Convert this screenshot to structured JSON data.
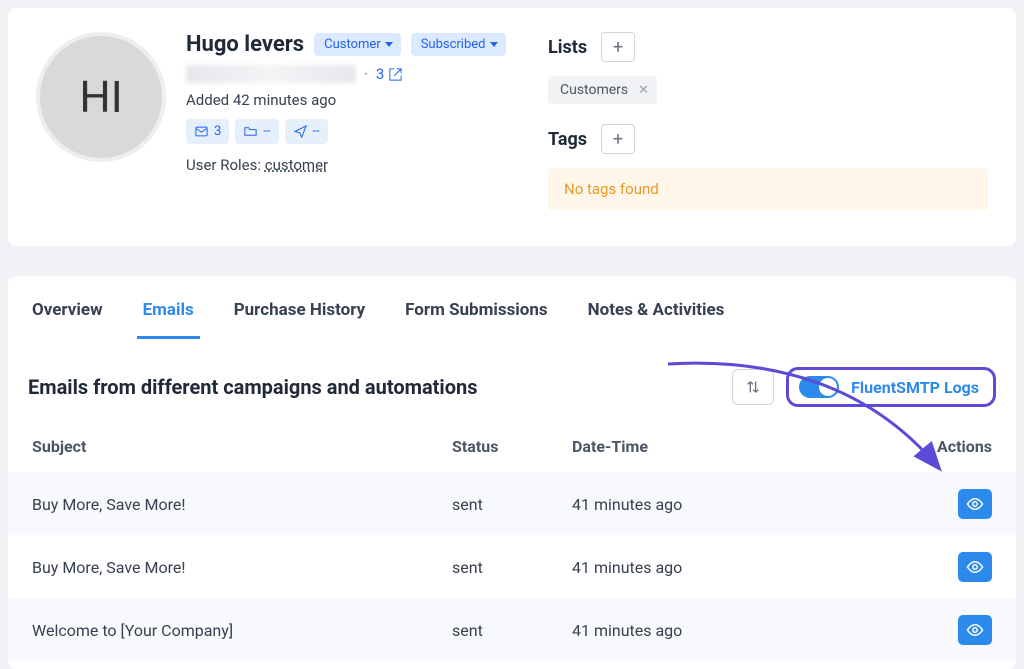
{
  "profile": {
    "avatar_initials": "HI",
    "name": "Hugo levers",
    "type_badge": "Customer",
    "status_badge": "Subscribed",
    "meta_number": "3",
    "added_text": "Added 42 minutes ago",
    "stats": {
      "mail_count": "3",
      "folder_count": "--",
      "send_count": "--"
    },
    "user_roles_label": "User Roles:",
    "user_role": "customer"
  },
  "lists": {
    "label": "Lists",
    "items": [
      "Customers"
    ]
  },
  "tags": {
    "label": "Tags",
    "empty_text": "No tags found"
  },
  "tabs": [
    "Overview",
    "Emails",
    "Purchase History",
    "Form Submissions",
    "Notes & Activities"
  ],
  "active_tab_index": 1,
  "emails_section": {
    "title": "Emails from different campaigns and automations",
    "smtp_label": "FluentSMTP Logs",
    "columns": {
      "subject": "Subject",
      "status": "Status",
      "datetime": "Date-Time",
      "actions": "Actions"
    },
    "rows": [
      {
        "subject": "Buy More, Save More!",
        "status": "sent",
        "datetime": "41 minutes ago"
      },
      {
        "subject": "Buy More, Save More!",
        "status": "sent",
        "datetime": "41 minutes ago"
      },
      {
        "subject": "Welcome to [Your Company]",
        "status": "sent",
        "datetime": "41 minutes ago"
      }
    ]
  }
}
